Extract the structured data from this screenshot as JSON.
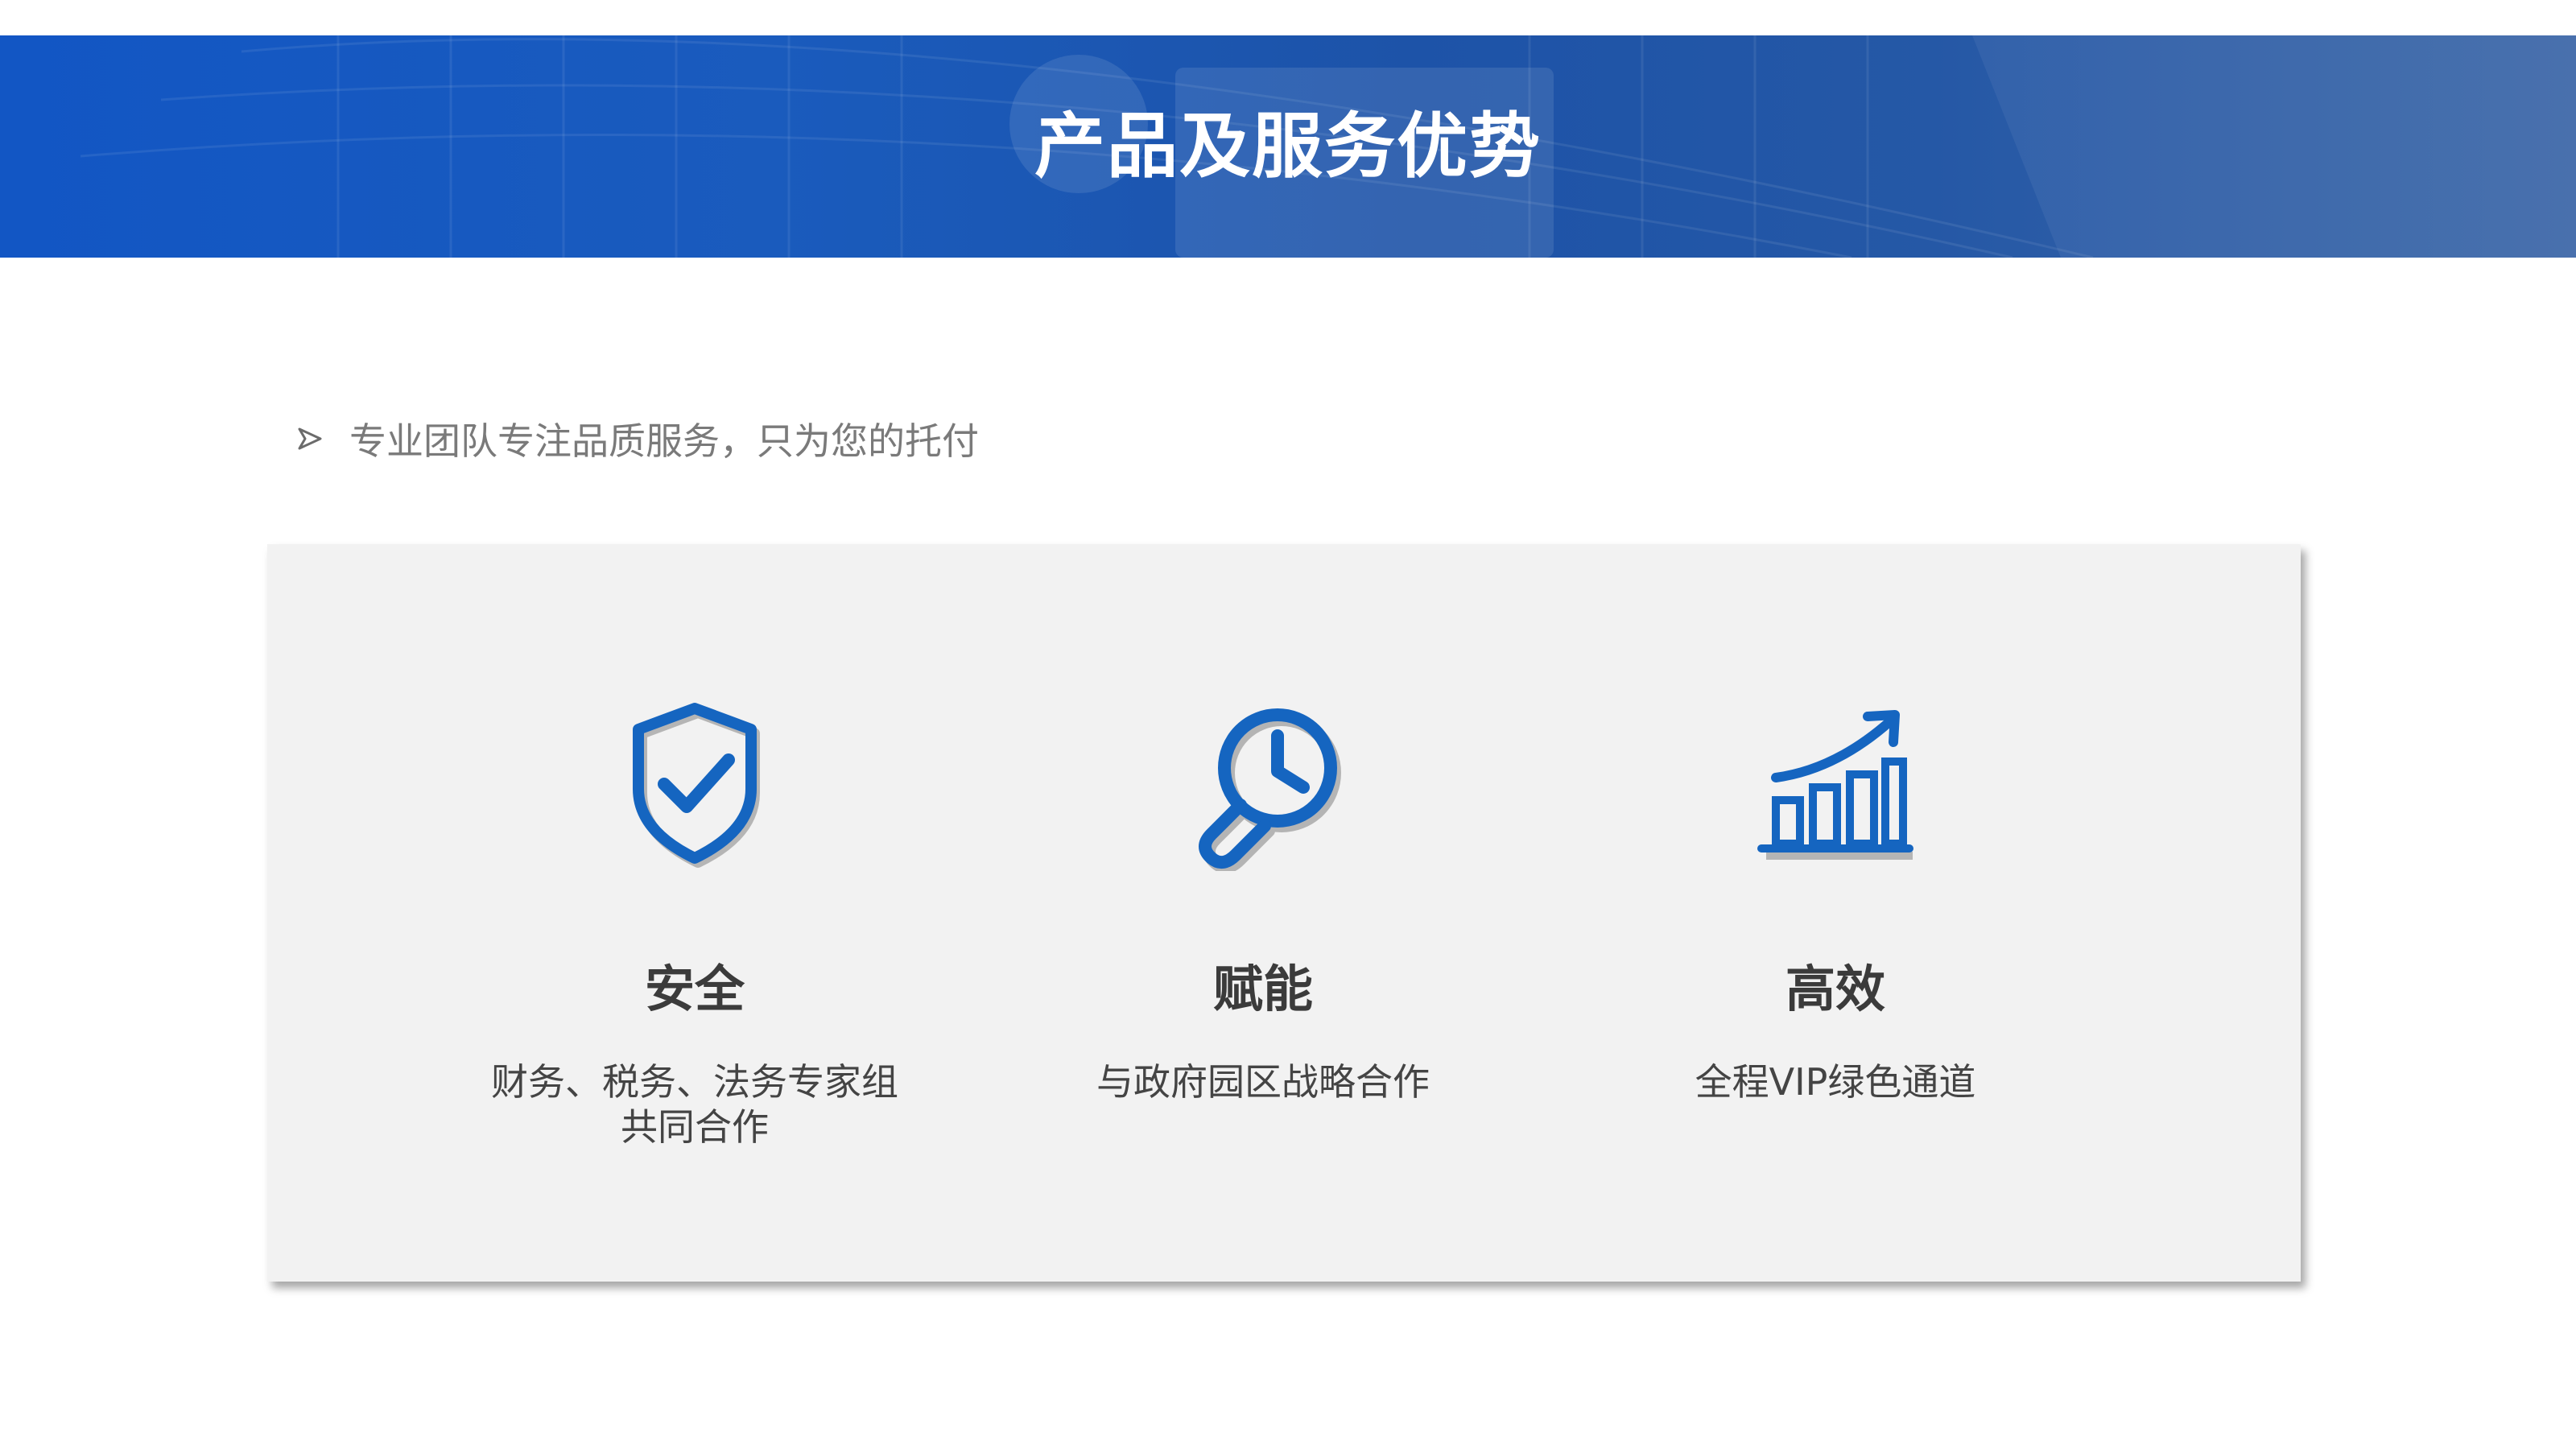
{
  "header": {
    "title": "产品及服务优势"
  },
  "subtitle": {
    "text": "专业团队专注品质服务，只为您的托付"
  },
  "features": [
    {
      "icon": "shield-check-icon",
      "title": "安全",
      "desc_line1": "财务、税务、法务专家组",
      "desc_line2": "共同合作"
    },
    {
      "icon": "bulb-wrench-icon",
      "title": "赋能",
      "desc_line1": "与政府园区战略合作",
      "desc_line2": ""
    },
    {
      "icon": "growth-chart-icon",
      "title": "高效",
      "desc_line1": "全程VIP绿色通道",
      "desc_line2": ""
    }
  ],
  "colors": {
    "accent": "#1565c0",
    "banner": "#1a5bbd",
    "panel": "#f2f2f2",
    "text": "#3b3b3b"
  }
}
